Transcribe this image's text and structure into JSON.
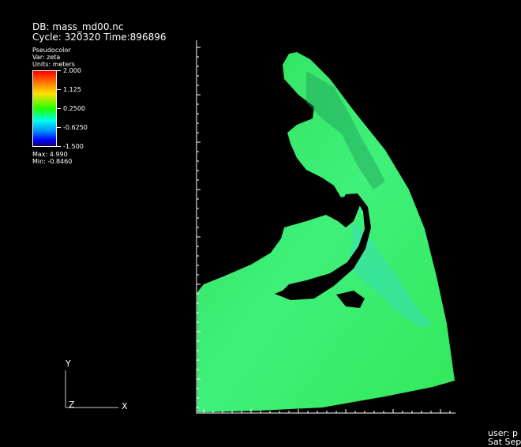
{
  "header": {
    "db_label": "DB: mass_md00.nc",
    "cycle_time": "Cycle: 320320   Time:896896"
  },
  "legend": {
    "plot_type": "Pseudocolor",
    "var": "Var: zeta",
    "units": "Units: meters",
    "ticks": [
      "2.000",
      "1.125",
      "0.2500",
      "-0.6250",
      "-1.500"
    ],
    "max": "Max: 4.990",
    "min": "Min: -0.8460"
  },
  "axes": {
    "y": "Y",
    "z": "Z",
    "x": "X"
  },
  "footer": {
    "user_line1": "user: p",
    "user_line2": "Sat Sep"
  },
  "colors": {
    "background": "#000000",
    "ocean": "#33e85a",
    "land": "#000000",
    "frame": "#ffffff"
  }
}
